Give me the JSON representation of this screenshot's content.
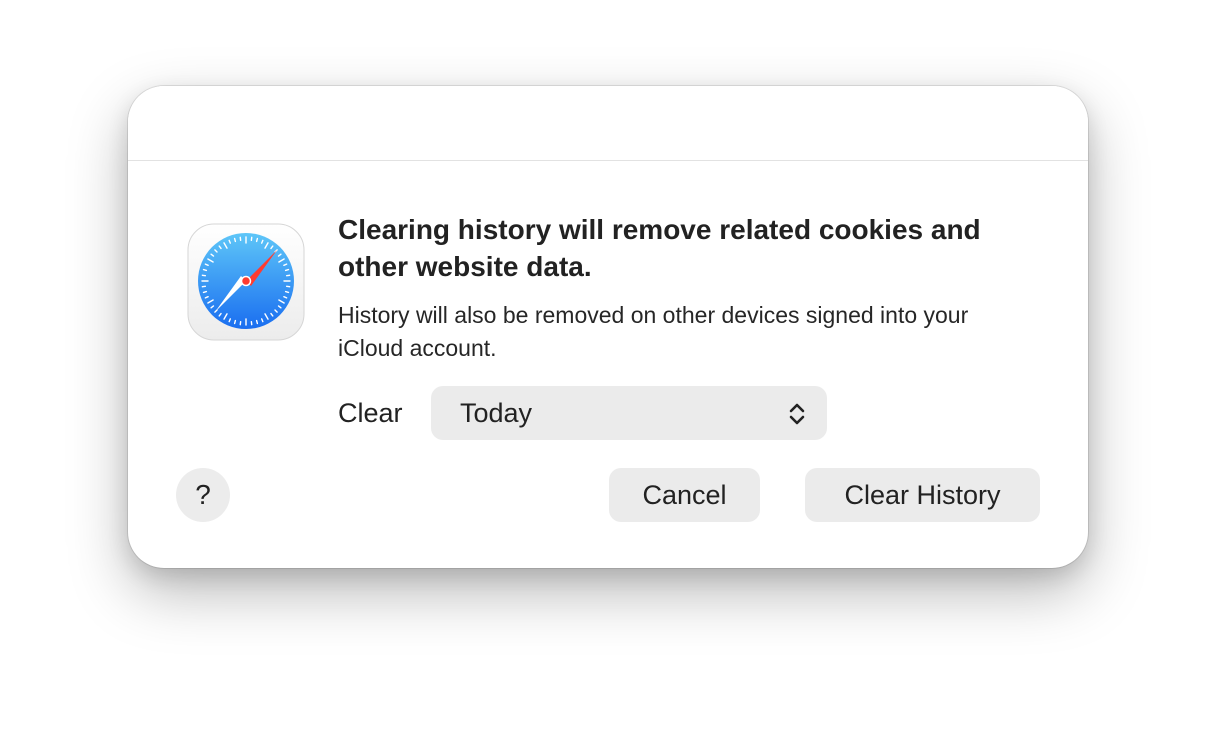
{
  "dialog": {
    "app_icon": "safari-compass-icon",
    "heading": "Clearing history will remove related cookies and other website data.",
    "message": "History will also be removed on other devices signed into your iCloud account.",
    "clear_label": "Clear",
    "period_select": {
      "selected": "Today",
      "icon": "chevron-up-down-icon"
    },
    "help_label": "?",
    "cancel_label": "Cancel",
    "confirm_label": "Clear History"
  },
  "colors": {
    "button_bg": "#ebebeb",
    "safari_blue_light": "#5ec6f8",
    "safari_blue_dark": "#1a6ef0",
    "needle_red": "#ff3b30"
  }
}
